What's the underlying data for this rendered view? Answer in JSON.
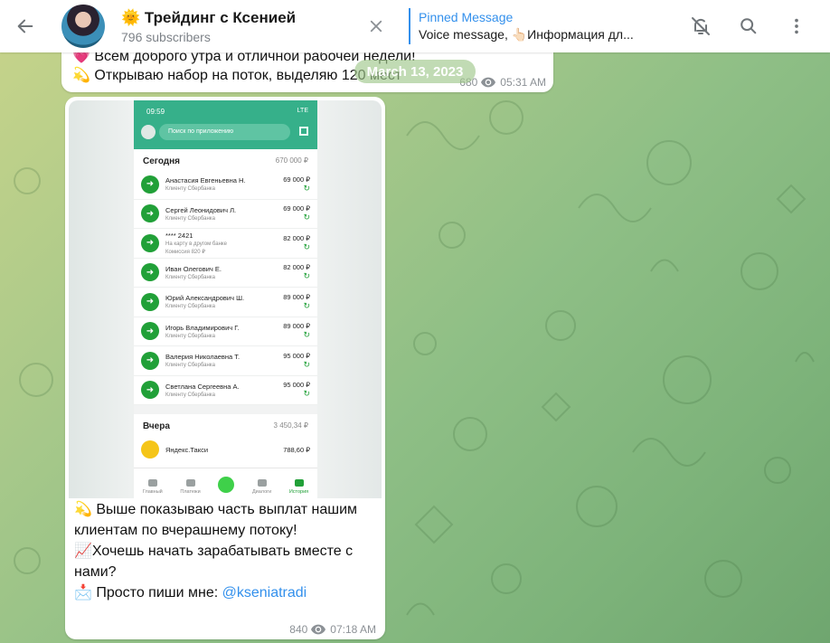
{
  "header": {
    "back_label": "←",
    "title": "🌞 Трейдинг с Ксенией",
    "subscribers": "796 subscribers",
    "pinned_title": "Pinned Message",
    "pinned_text": "Voice message, 👆🏻Информация дл..."
  },
  "date_pill": "March 13, 2023",
  "message1": {
    "line1": "💗 Всем доброго утра и отличной рабочей недели!",
    "line2": "💫 Открываю набор на поток, выделяю 120 мест",
    "views": "680",
    "time": "05:31 AM"
  },
  "phone": {
    "status_time": "09:59",
    "status_right": "LTE",
    "search_placeholder": "Поиск по приложению",
    "today_label": "Сегодня",
    "today_sum": "670 000 ₽",
    "rows": [
      {
        "name": "Анастасия Евгеньевна Н.",
        "desc": "Клиенту Сбербанка",
        "desc2": "",
        "amount": "69 000 ₽"
      },
      {
        "name": "Сергей Леонидович Л.",
        "desc": "Клиенту Сбербанка",
        "desc2": "",
        "amount": "69 000 ₽"
      },
      {
        "name": "**** 2421",
        "desc": "На карту в другом банке",
        "desc2": "Комиссия 820 ₽",
        "amount": "82 000 ₽"
      },
      {
        "name": "Иван Олегович Е.",
        "desc": "Клиенту Сбербанка",
        "desc2": "",
        "amount": "82 000 ₽"
      },
      {
        "name": "Юрий Александрович Ш.",
        "desc": "Клиенту Сбербанка",
        "desc2": "",
        "amount": "89 000 ₽"
      },
      {
        "name": "Игорь Владимирович Г.",
        "desc": "Клиенту Сбербанка",
        "desc2": "",
        "amount": "89 000 ₽"
      },
      {
        "name": "Валерия Николаевна Т.",
        "desc": "Клиенту Сбербанка",
        "desc2": "",
        "amount": "95 000 ₽"
      },
      {
        "name": "Светлана Сергеевна А.",
        "desc": "Клиенту Сбербанка",
        "desc2": "",
        "amount": "95 000 ₽"
      }
    ],
    "yesterday_label": "Вчера",
    "yesterday_sum": "3 450,34 ₽",
    "yesterday_row": {
      "name": "Яндекс.Такси",
      "amount": "788,60 ₽"
    },
    "nav": [
      "Главный",
      "Платежи",
      "",
      "Диалоги",
      "История"
    ]
  },
  "message2": {
    "caption_line1": "💫 Выше показываю часть выплат нашим клиентам по вчерашнему потоку!",
    "caption_line2": "📈Хочешь начать зарабатывать вместе с нами?",
    "caption_line3_prefix": "📩 Просто пиши мне: ",
    "caption_link": "@kseniatradi",
    "views": "840",
    "time": "07:18 AM"
  },
  "colors": {
    "accent": "#3390ec",
    "sber_green": "#21a038",
    "header_bg": "#ffffff"
  }
}
